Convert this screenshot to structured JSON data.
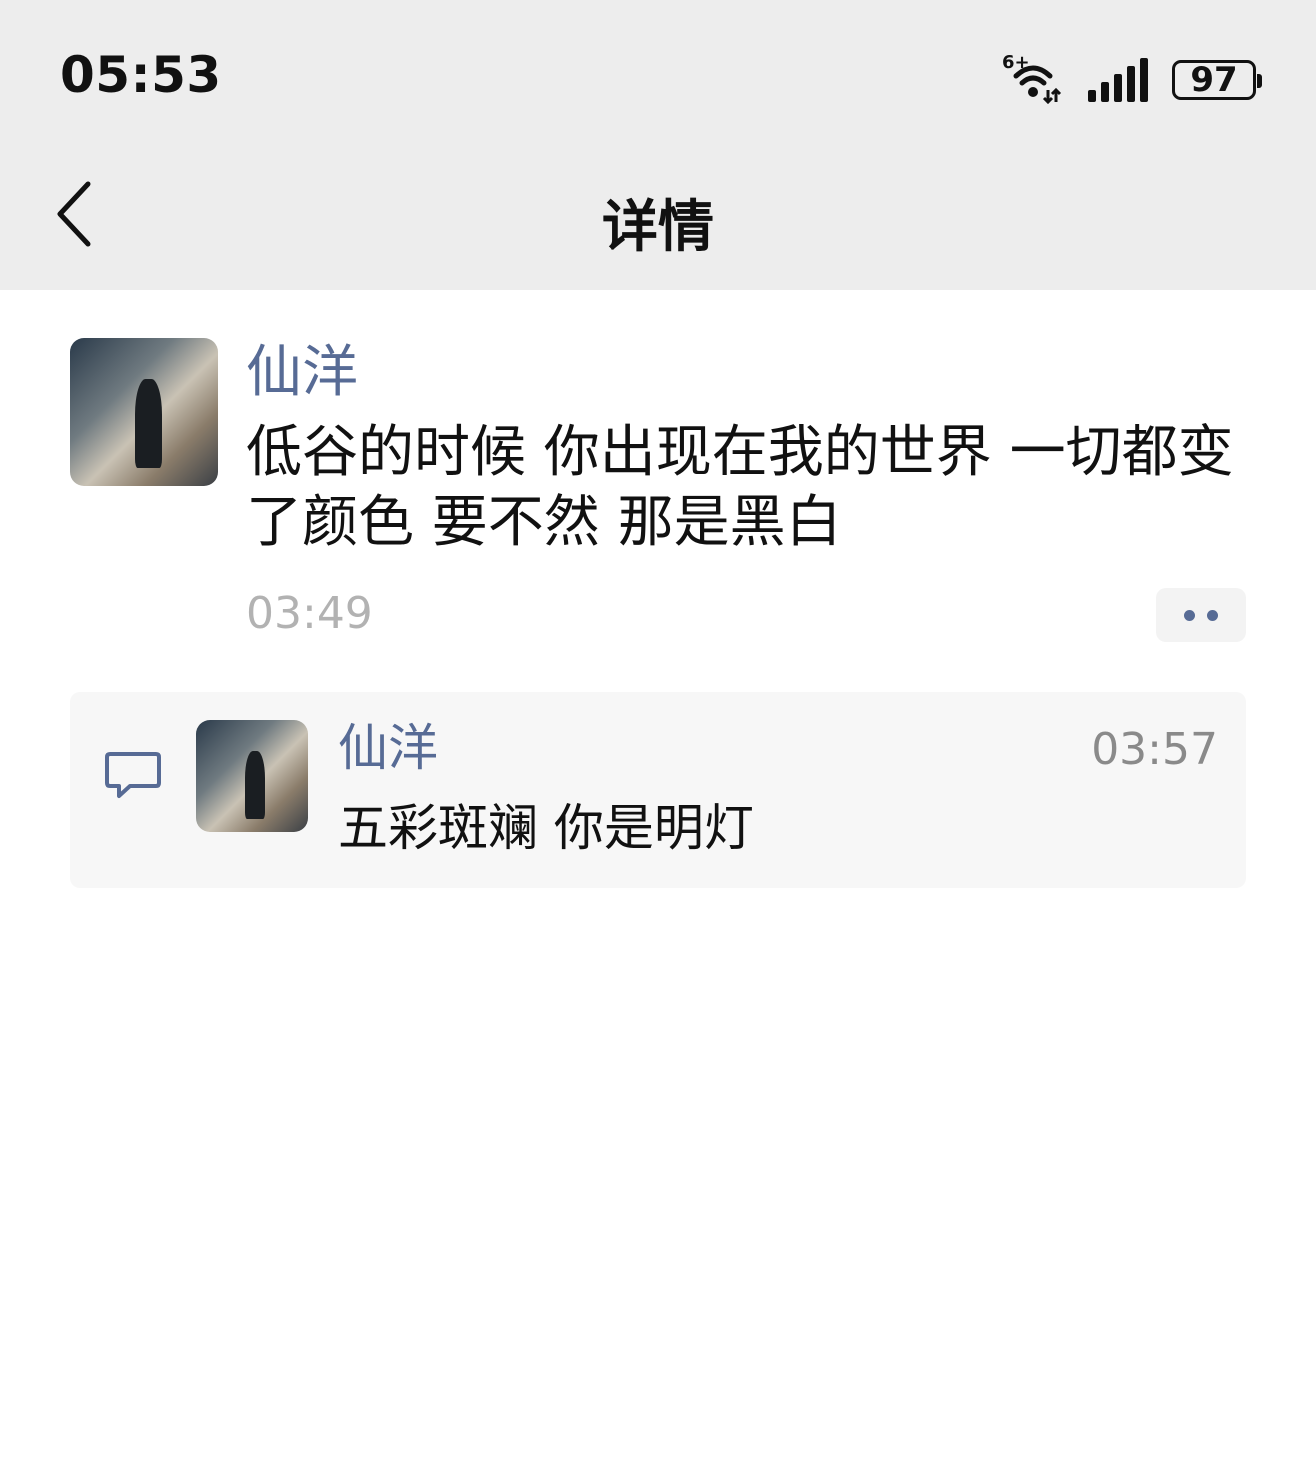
{
  "status_bar": {
    "time": "05:53",
    "wifi_tag": "6+",
    "battery": "97",
    "icons": [
      "wifi-icon",
      "signal-icon",
      "battery-icon"
    ]
  },
  "nav": {
    "title": "详情",
    "back_icon": "chevron-left-icon"
  },
  "post": {
    "author": "仙洋",
    "text": "低谷的时候 你出现在我的世界 一切都变了颜色 要不然 那是黑白",
    "time": "03:49",
    "more_icon": "ellipsis-icon"
  },
  "comments": [
    {
      "author": "仙洋",
      "time": "03:57",
      "text": "五彩斑斓 你是明灯"
    }
  ],
  "colors": {
    "bar_bg": "#ededed",
    "name_blue": "#576b95",
    "time_gray": "#b2b2b2",
    "comment_bg": "#f7f7f7"
  }
}
